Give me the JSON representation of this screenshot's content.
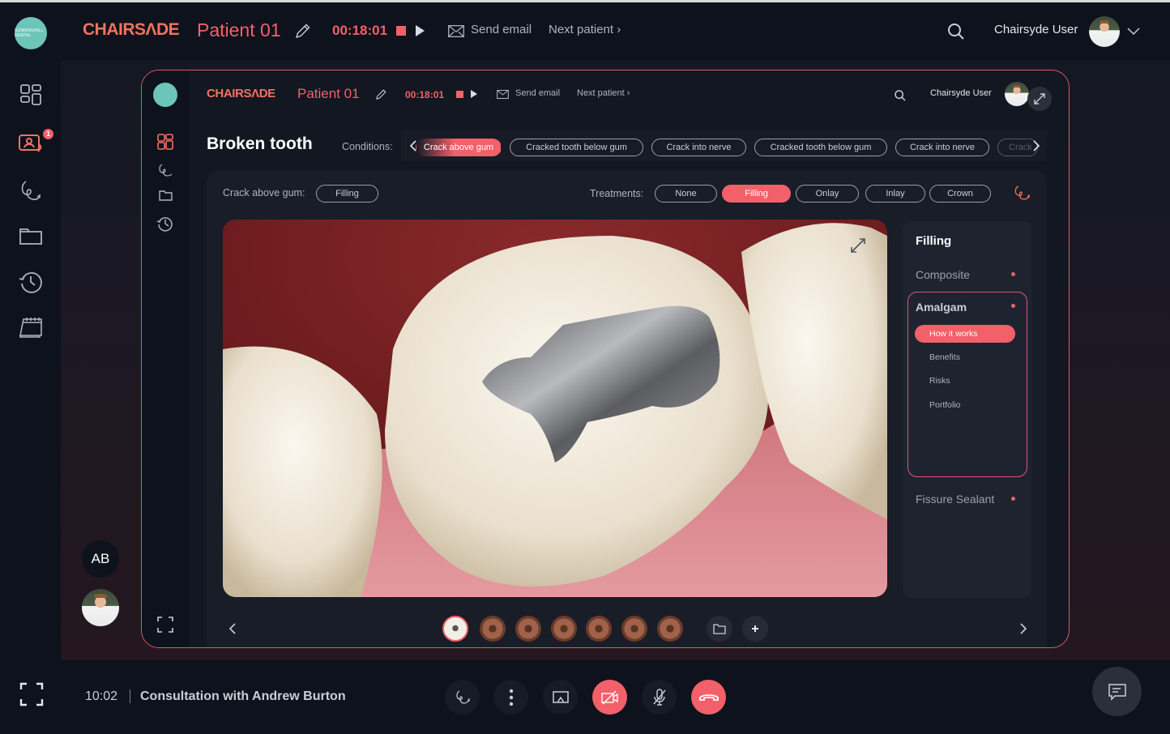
{
  "app": {
    "brand": "CHAIRSΛDE",
    "clinic_logo_text": "SUNNINGHILL DENTAL",
    "patient_name": "Patient 01",
    "timer": "00:18:01",
    "send_email": "Send email",
    "next_patient": "Next patient",
    "user_name": "Chairsyde User"
  },
  "sidebar": {
    "items": [
      {
        "icon": "dashboard-grid-icon"
      },
      {
        "icon": "video-call-icon",
        "badge": "1",
        "active": true
      },
      {
        "icon": "scribble-icon"
      },
      {
        "icon": "folder-icon"
      },
      {
        "icon": "history-icon"
      },
      {
        "icon": "calendar-icon"
      }
    ],
    "initials": "AB"
  },
  "inner": {
    "brand": "CHAIRSΛDE",
    "patient_name": "Patient 01",
    "timer": "00:18:01",
    "send_email": "Send email",
    "next_patient": "Next patient",
    "user_name": "Chairsyde User",
    "page_title": "Broken tooth",
    "conditions_label": "Conditions:",
    "conditions": [
      {
        "label": "Crack above gum",
        "active": true
      },
      {
        "label": "Cracked tooth below gum"
      },
      {
        "label": "Crack into nerve"
      },
      {
        "label": "Cracked tooth below gum"
      },
      {
        "label": "Crack into nerve"
      },
      {
        "label": "Crack"
      }
    ],
    "selected_condition_label": "Crack above gum:",
    "selected_condition_value": "Filling",
    "treatments_label": "Treatments:",
    "treatments": [
      {
        "label": "None"
      },
      {
        "label": "Filling",
        "active": true
      },
      {
        "label": "Onlay"
      },
      {
        "label": "Inlay"
      },
      {
        "label": "Crown"
      }
    ],
    "image_alt": "3D render of molar with amalgam filling",
    "thumbnails_count": 7,
    "active_thumbnail": 1,
    "menu": {
      "title": "Filling",
      "items": [
        {
          "label": "Composite"
        },
        {
          "label": "Amalgam",
          "expanded": true,
          "sub": [
            {
              "label": "How it works",
              "active": true
            },
            {
              "label": "Benefits"
            },
            {
              "label": "Risks"
            },
            {
              "label": "Portfolio"
            }
          ]
        },
        {
          "label": "Fissure Sealant"
        }
      ]
    }
  },
  "bottom": {
    "time": "10:02",
    "consultation": "Consultation with Andrew Burton"
  },
  "colors": {
    "accent": "#f2606a",
    "brand": "#f0735e",
    "background": "#0d121c",
    "teal_logo": "#6cc5b8"
  }
}
